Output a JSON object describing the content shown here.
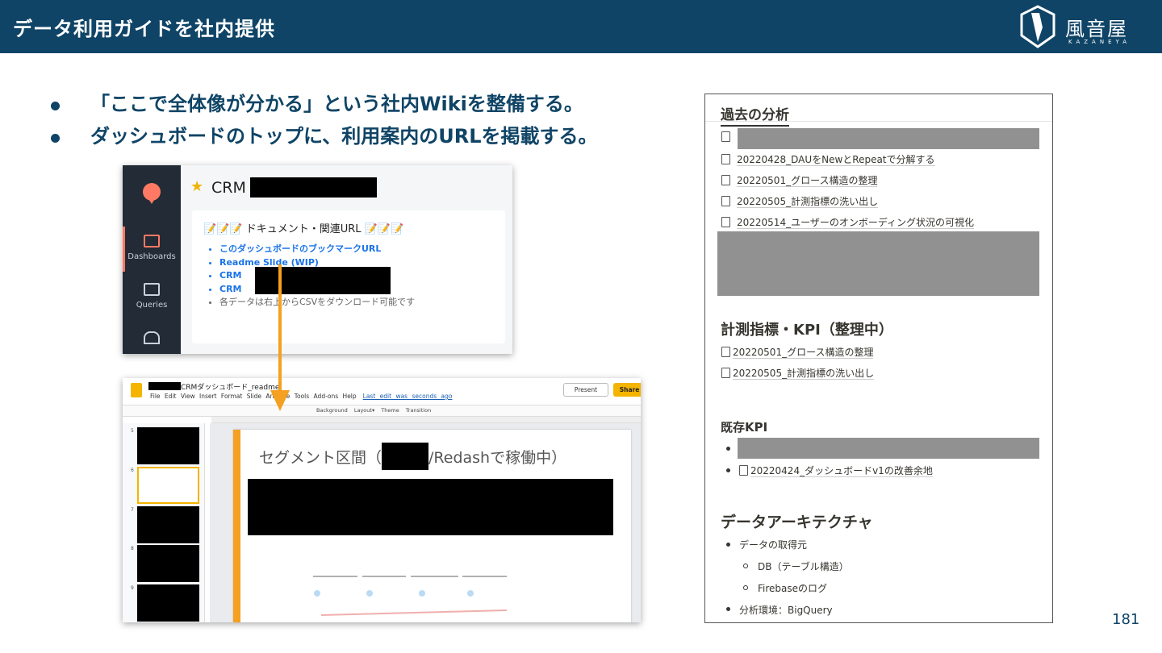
{
  "header": {
    "title": "データ利用ガイドを社内提供",
    "logo_text": "風音屋",
    "logo_sub": "KAZANEYA"
  },
  "bullets": [
    "「ここで全体像が分かる」という社内Wikiを整備する。",
    "ダッシュボードのトップに、利用案内のURLを掲載する。"
  ],
  "redash": {
    "nav": [
      "Dashboards",
      "Queries"
    ],
    "title": "CRM",
    "card_heading": "📝📝📝 ドキュメント・関連URL 📝📝📝",
    "links": [
      "このダッシュボードのブックマークURL",
      "Readme Slide (WIP)",
      "CRM",
      "CRM"
    ],
    "note": "各データは右上からCSVをダウンロード可能です"
  },
  "slides": {
    "doc_name": "CRMダッシュボード_readme",
    "menu": "File Edit View Insert Format Slide Arrange Tools Add-ons Help",
    "last_edit": "Last edit was seconds ago",
    "present": "Present",
    "share": "Share",
    "toolbar": "Background Layout▾ Theme Transition",
    "slide_numbers": [
      "5",
      "6",
      "7",
      "8",
      "9"
    ],
    "slide_title_prefix": "セグメント区間（",
    "slide_title_suffix": "/Redashで稼働中）"
  },
  "wiki": {
    "section1": "過去の分析",
    "items1": [
      "20220428_DAUをNewとRepeatで分解する",
      "20220501_グロース構造の整理",
      "20220505_計測指標の洗い出し",
      "20220514_ユーザーのオンボーディング状況の可視化"
    ],
    "section2": "計測指標・KPI（整理中）",
    "items2": [
      "20220501_グロース構造の整理",
      "20220505_計測指標の洗い出し"
    ],
    "section3": "既存KPI",
    "items3": [
      "20220424_ダッシュボードv1の改善余地"
    ],
    "section4": "データアーキテクチャ",
    "arch": [
      "データの取得元",
      "DB（テーブル構造）",
      "Firebaseのログ",
      "分析環境：BigQuery"
    ]
  },
  "page_number": "181",
  "colors": {
    "brand": "#0f4466",
    "accent": "#f5a020",
    "redash_sidebar": "#222b36"
  }
}
